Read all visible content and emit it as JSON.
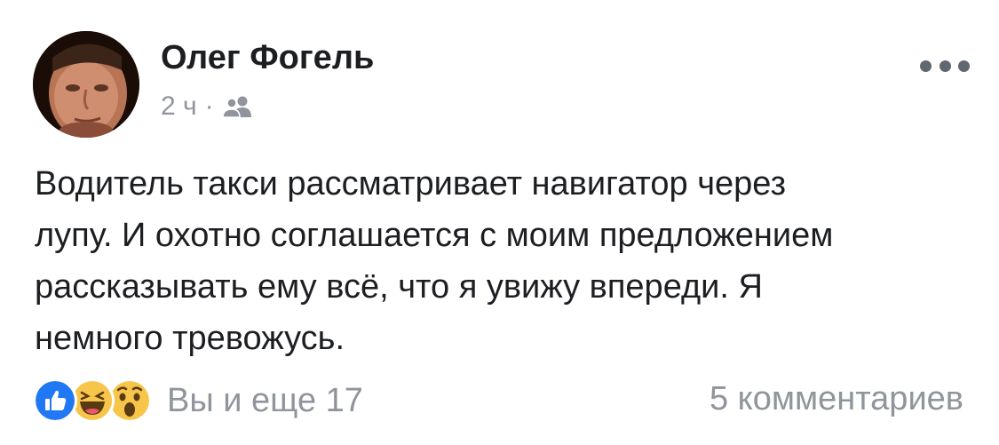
{
  "post": {
    "author": "Олег Фогель",
    "time": "2 ч",
    "separator": "·",
    "audience_icon": "friends-icon",
    "more_icon": "ellipsis-icon",
    "text_lines": [
      "Водитель такси рассматривает навигатор через",
      "лупу. И охотно соглашается с моим предложением",
      "рассказывать ему всё, что я увижу впереди. Я",
      "немного тревожусь."
    ],
    "reactions": {
      "icons": [
        "like-reaction-icon",
        "haha-reaction-icon",
        "wow-reaction-icon"
      ],
      "text": "Вы и еще 17"
    },
    "comments_label": "5 комментариев"
  },
  "colors": {
    "text_primary": "#1c1e21",
    "text_secondary": "#90949c",
    "like_blue": "#2078f4",
    "emoji_yellow": "#f7c54a"
  }
}
